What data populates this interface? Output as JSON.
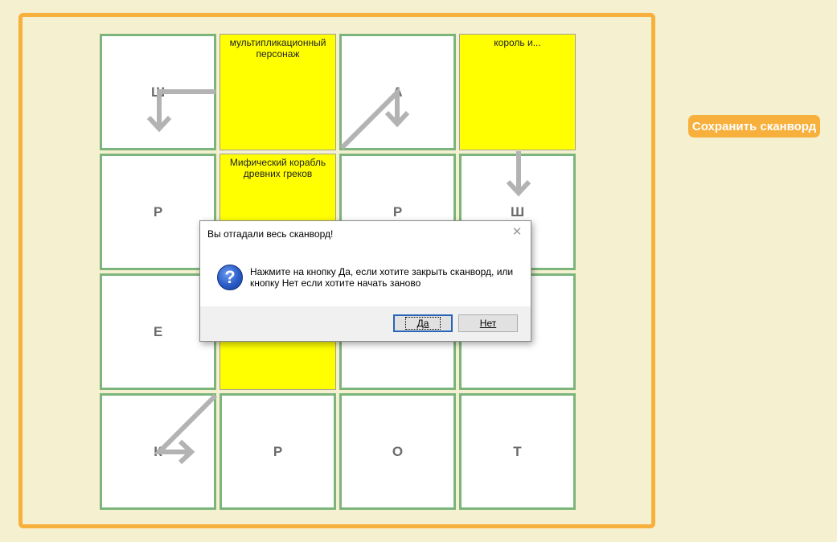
{
  "save_button": "Сохранить сканворд",
  "grid": {
    "cells": [
      {
        "type": "letter",
        "text": "Ш"
      },
      {
        "type": "clue",
        "text": "мультипликационный персонаж"
      },
      {
        "type": "letter",
        "text": "А"
      },
      {
        "type": "clue",
        "text": "король и..."
      },
      {
        "type": "letter",
        "text": "Р"
      },
      {
        "type": "clue",
        "text": "Мифический корабль древних греков"
      },
      {
        "type": "letter",
        "text": "Р"
      },
      {
        "type": "letter",
        "text": "Ш"
      },
      {
        "type": "letter",
        "text": "Е"
      },
      {
        "type": "clue",
        "text": ""
      },
      {
        "type": "letter",
        "text": ""
      },
      {
        "type": "letter",
        "text": ""
      },
      {
        "type": "letter",
        "text": "К"
      },
      {
        "type": "letter",
        "text": "Р"
      },
      {
        "type": "letter",
        "text": "О"
      },
      {
        "type": "letter",
        "text": "Т"
      }
    ]
  },
  "dialog": {
    "title": "Вы отгадали весь сканворд!",
    "close": "✕",
    "icon": "question-icon",
    "icon_glyph": "?",
    "message": "Нажмите на кнопку Да, если хотите закрыть сканворд, или кнопку Нет если хотите начать заново",
    "yes": "Да",
    "no": "Нет"
  },
  "colors": {
    "frame": "#f7b03c",
    "cell_border": "#7bb57b",
    "clue_bg": "#ffff00",
    "background": "#f5f0cf"
  }
}
